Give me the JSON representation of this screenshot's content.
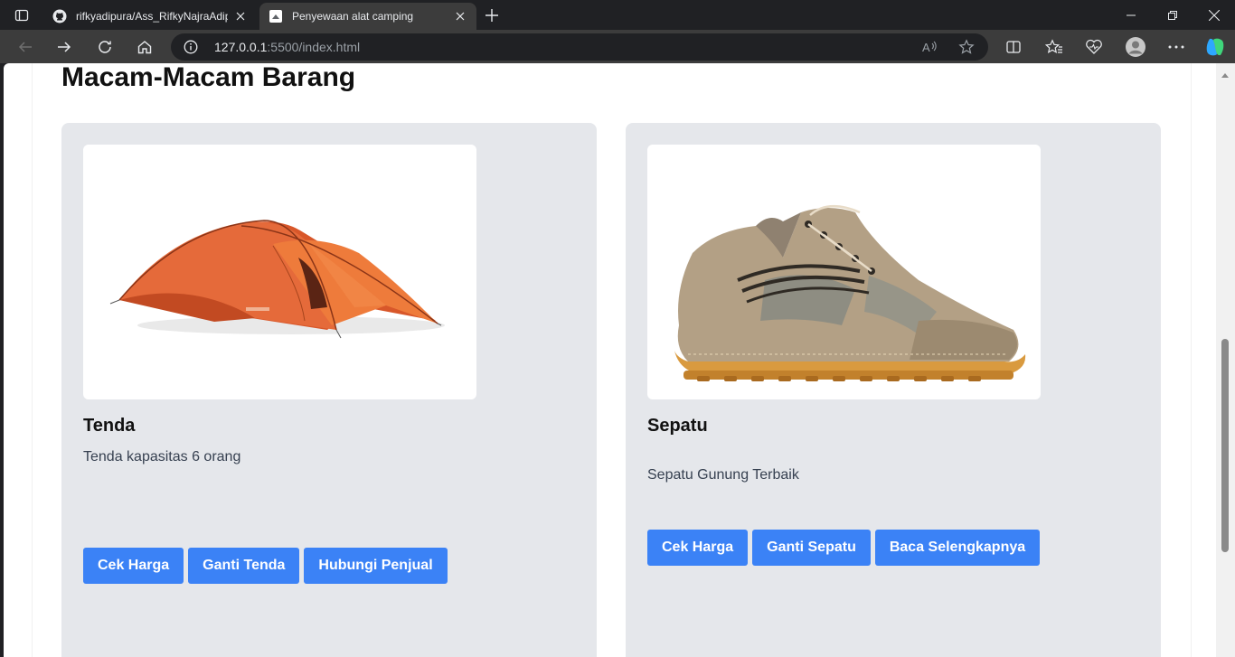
{
  "browser": {
    "tabs": [
      {
        "title": "rifkyadipura/Ass_RifkyNajraAdipu",
        "favicon": "github-icon"
      },
      {
        "title": "Penyewaan alat camping",
        "favicon": "page-icon"
      }
    ],
    "url_host": "127.0.0.1",
    "url_rest": ":5500/index.html"
  },
  "page": {
    "heading": "Macam-Macam Barang",
    "cards": [
      {
        "title": "Tenda",
        "description": "Tenda kapasitas 6 orang",
        "image": "tent-image",
        "buttons": [
          "Cek Harga",
          "Ganti Tenda",
          "Hubungi Penjual"
        ]
      },
      {
        "title": "Sepatu",
        "description": "Sepatu Gunung Terbaik",
        "image": "hiking-boot-image",
        "buttons": [
          "Cek Harga",
          "Ganti Sepatu",
          "Baca Selengkapnya"
        ]
      }
    ]
  },
  "colors": {
    "card_bg": "#e5e7eb",
    "button_bg": "#3b82f6",
    "button_text": "#ffffff"
  }
}
